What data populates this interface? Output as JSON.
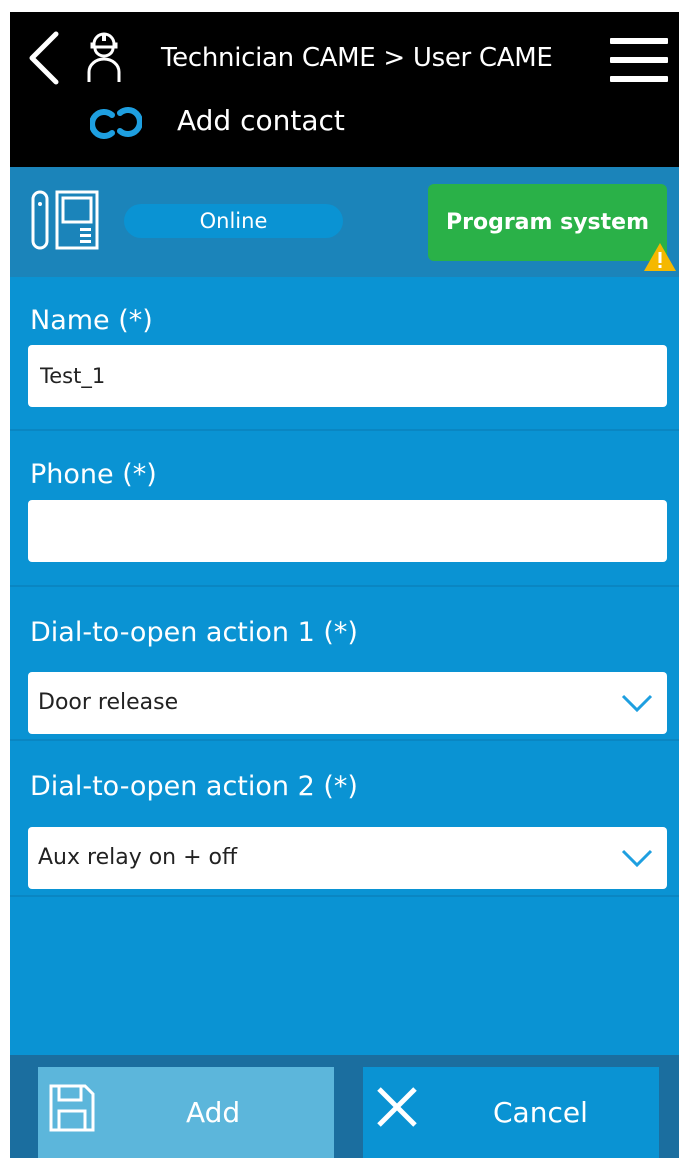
{
  "header": {
    "breadcrumb": "Technician CAME > User CAME",
    "title": "Add contact",
    "icons": [
      "chevron-left-icon",
      "technician-icon",
      "menu-icon",
      "came-cloud-icon"
    ]
  },
  "status": {
    "connection": "Online",
    "program_button": "Program system",
    "icons": [
      "intercom-device-icon",
      "warning-icon"
    ]
  },
  "form": {
    "name": {
      "label": "Name (*)",
      "value": "Test_1"
    },
    "phone": {
      "label": "Phone (*)",
      "value": ""
    },
    "action1": {
      "label": "Dial-to-open action 1 (*)",
      "value": "Door release"
    },
    "action2": {
      "label": "Dial-to-open action 2 (*)",
      "value": "Aux relay on + off"
    }
  },
  "footer": {
    "add_label": "Add",
    "cancel_label": "Cancel",
    "icons": [
      "save-icon",
      "close-icon"
    ]
  },
  "colors": {
    "header_bg": "#000000",
    "status_bg": "#1b84ba",
    "form_bg": "#0a93d3",
    "program_green": "#2ab148",
    "warning": "#f5b800",
    "add_button": "#5cb6db",
    "footer_bg": "#1b6e9f"
  }
}
